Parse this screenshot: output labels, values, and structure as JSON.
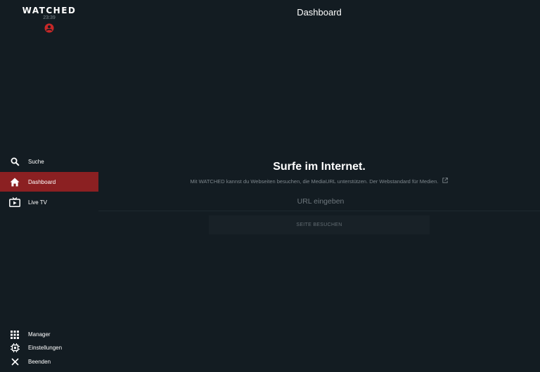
{
  "app": {
    "logo_text": "WATCHED",
    "clock": "23:39"
  },
  "header": {
    "title": "Dashboard"
  },
  "sidebar": {
    "items": [
      {
        "label": "Suche",
        "icon": "search-icon"
      },
      {
        "label": "Dashboard",
        "icon": "home-icon",
        "active": true
      },
      {
        "label": "Live TV",
        "icon": "tv-icon"
      }
    ],
    "bottom_items": [
      {
        "label": "Manager",
        "icon": "grid-icon"
      },
      {
        "label": "Einstellungen",
        "icon": "chip-icon"
      },
      {
        "label": "Beenden",
        "icon": "close-icon"
      }
    ]
  },
  "main": {
    "headline": "Surfe im Internet.",
    "description": "Mit WATCHED kannst du Webseiten besuchen, die MediaURL unterstützen. Der Webstandard für Medien.",
    "url_placeholder": "URL eingeben",
    "url_value": "",
    "visit_button": "SEITE BESUCHEN"
  },
  "colors": {
    "background": "#131c22",
    "accent": "#8b2022",
    "user_icon": "#c62828"
  }
}
